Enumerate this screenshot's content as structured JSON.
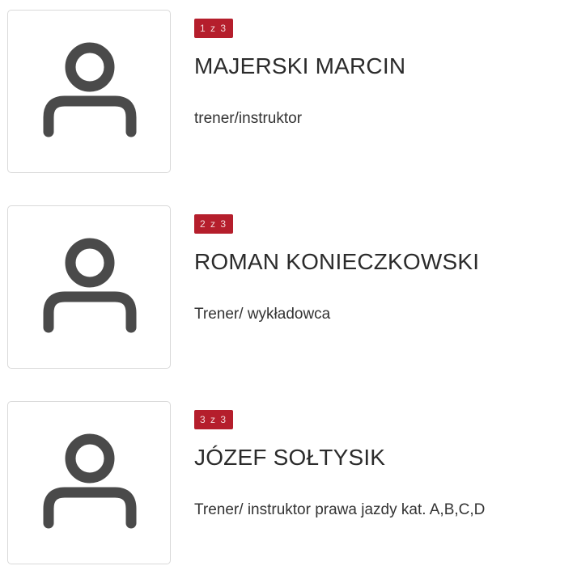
{
  "people": [
    {
      "counter": "1 z 3",
      "name": "MAJERSKI MARCIN",
      "role": "trener/instruktor",
      "icon": "user-icon"
    },
    {
      "counter": "2 z 3",
      "name": "ROMAN KONIECZKOWSKI",
      "role": "Trener/ wykładowca",
      "icon": "user-icon"
    },
    {
      "counter": "3 z 3",
      "name": "JÓZEF SOŁTYSIK",
      "role": "Trener/ instruktor prawa jazdy kat. A,B,C,D",
      "icon": "user-icon"
    }
  ],
  "colors": {
    "badge_background": "#b51e2c",
    "icon": "#4a4a4a",
    "border": "#d9d9d9"
  }
}
